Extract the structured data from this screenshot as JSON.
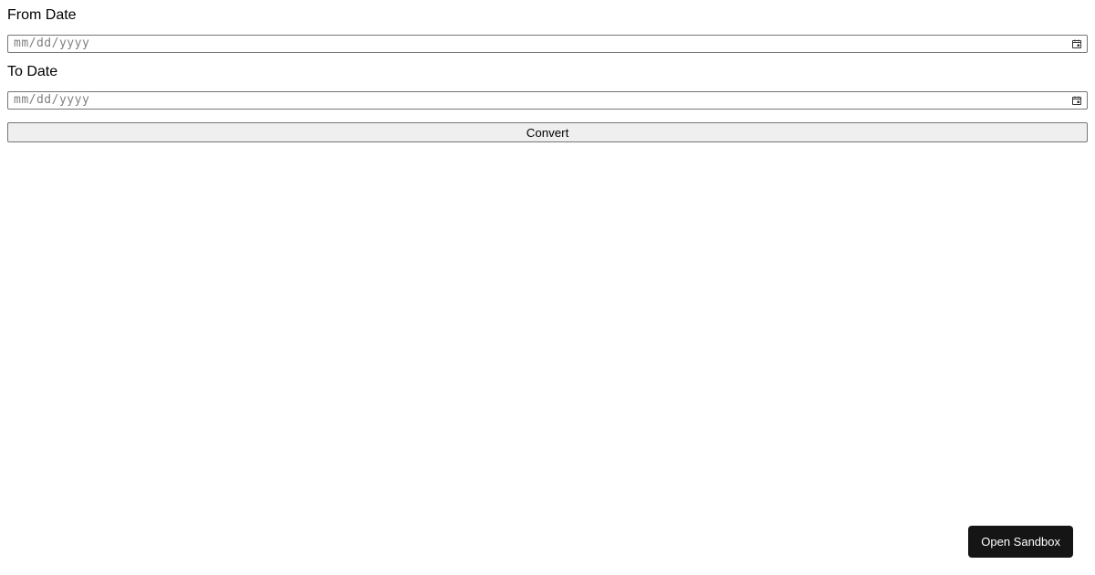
{
  "form": {
    "from_label": "From Date",
    "to_label": "To Date",
    "date_placeholder": "mm/dd/yyyy",
    "from_value": "",
    "to_value": "",
    "convert_label": "Convert"
  },
  "footer": {
    "open_sandbox_label": "Open Sandbox"
  }
}
